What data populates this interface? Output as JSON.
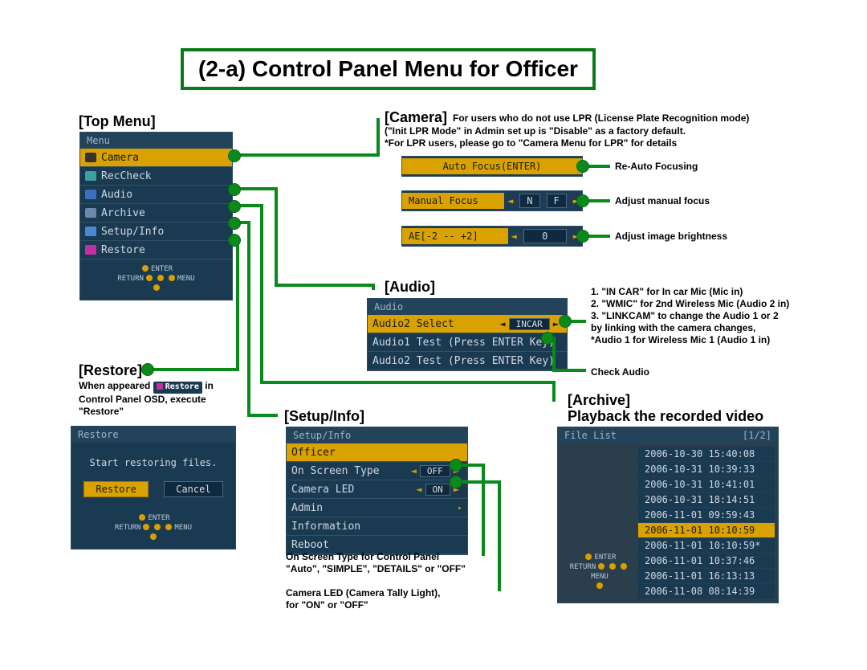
{
  "title": "(2-a) Control Panel Menu for Officer",
  "sections": {
    "top_menu": "[Top Menu]",
    "restore": "[Restore]",
    "camera": "[Camera]",
    "audio": "[Audio]",
    "setup": "[Setup/Info]",
    "archive_h": "[Archive]",
    "archive_sub": "Playback the recorded video"
  },
  "menu": {
    "hdr": "Menu",
    "items": [
      "Camera",
      "RecCheck",
      "Audio",
      "Archive",
      "Setup/Info",
      "Restore"
    ]
  },
  "camera_notes": {
    "l1": "For users who do not use LPR (License Plate Recognition mode)",
    "l2": "(\"Init LPR Mode\" in Admin set up is \"Disable\" as a factory default.",
    "l3": "*For LPR users, please go to \"Camera Menu for LPR\" for details"
  },
  "camera_pill1": "Auto Focus(ENTER)",
  "camera_pill2": {
    "label": "Manual Focus",
    "left": "N",
    "right": "F"
  },
  "camera_pill3": {
    "label": "AE[-2 -- +2]",
    "val": "0"
  },
  "camera_anno": {
    "a1": "Re-Auto Focusing",
    "a2": "Adjust manual focus",
    "a3": "Adjust image brightness"
  },
  "audio_panel": {
    "hdr": "Audio",
    "r1": {
      "label": "Audio2 Select",
      "val": "INCAR"
    },
    "r2": "Audio1 Test (Press ENTER Key)",
    "r3": "Audio2 Test (Press ENTER Key)"
  },
  "audio_notes": {
    "l1": "1. \"IN CAR\" for In car Mic (Mic in)",
    "l2": "2. \"WMIC\" for 2nd Wireless Mic  (Audio 2 in)",
    "l3": "3. \"LINKCAM\" to change the Audio 1 or 2",
    "l4": "by linking with the camera changes,",
    "l5": "*Audio 1 for Wireless Mic 1 (Audio 1 in)",
    "check": "Check Audio"
  },
  "setup_panel": {
    "hdr": "Setup/Info",
    "items": [
      {
        "label": "Officer",
        "val": ""
      },
      {
        "label": "On Screen Type",
        "val": "OFF"
      },
      {
        "label": "Camera LED",
        "val": "ON"
      },
      {
        "label": "Admin",
        "val": "▸"
      },
      {
        "label": "Information",
        "val": ""
      },
      {
        "label": "Reboot",
        "val": ""
      }
    ]
  },
  "setup_notes": {
    "l1": "On Screen Type for Control Panel",
    "l2": "\"Auto\", \"SIMPLE\", \"DETAILS\" or \"OFF\"",
    "l3": "Camera LED (Camera Tally Light),",
    "l4": "for \"ON\" or \"OFF\""
  },
  "restore_panel": {
    "hdr": "Restore",
    "msg": "Start restoring files.",
    "b1": "Restore",
    "b2": "Cancel"
  },
  "restore_notes": {
    "l1": "When appeared",
    "l2": "in",
    "l3": "Control Panel OSD, execute",
    "l4": "\"Restore\"",
    "tag": "Restore"
  },
  "archive_panel": {
    "hdr": "File List",
    "page": "[1/2]",
    "files": [
      "2006-10-30 15:40:08",
      "2006-10-31 10:39:33",
      "2006-10-31 10:41:01",
      "2006-10-31 18:14:51",
      "2006-11-01 09:59:43",
      "2006-11-01 10:10:59",
      "2006-11-01 10:10:59*",
      "2006-11-01 10:37:46",
      "2006-11-01 16:13:13",
      "2006-11-08 08:14:39"
    ]
  },
  "nav": {
    "enter": "ENTER",
    "return": "RETURN",
    "menu": "MENU"
  }
}
